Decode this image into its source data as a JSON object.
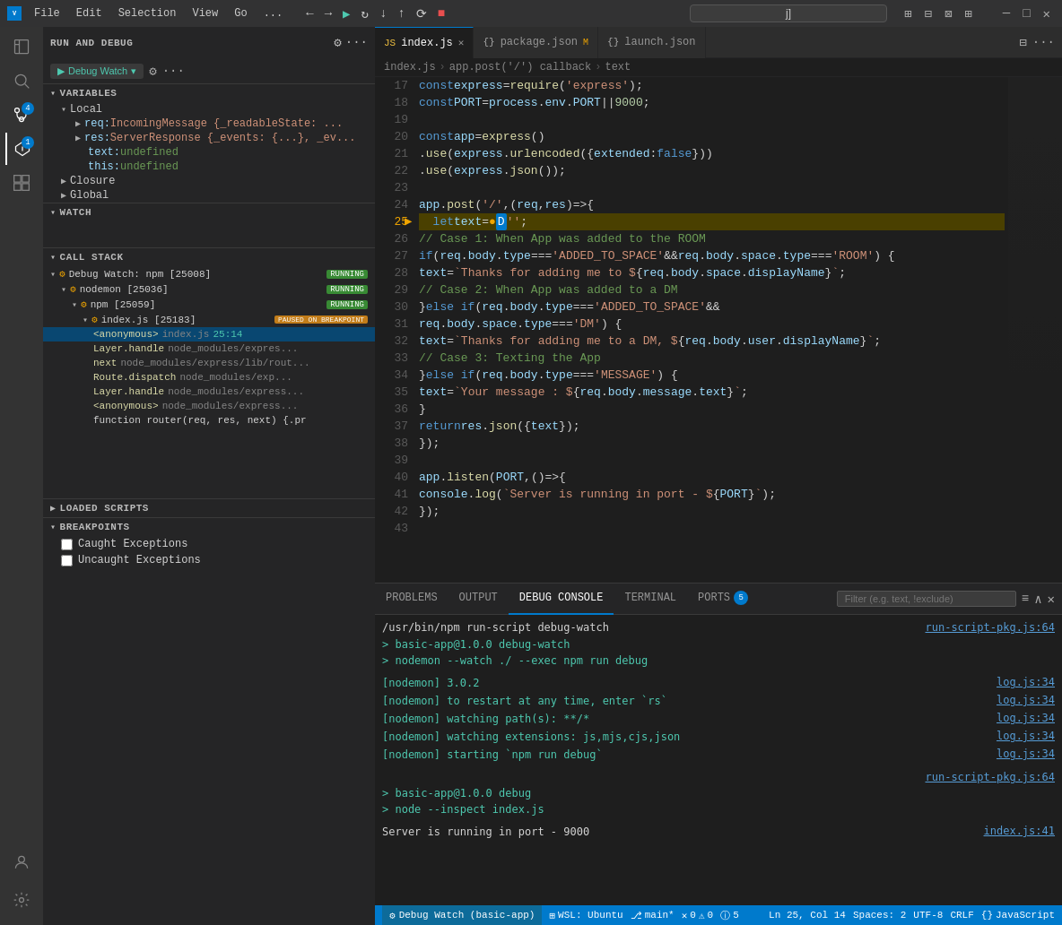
{
  "titlebar": {
    "menus": [
      "File",
      "Edit",
      "Selection",
      "View",
      "Go",
      "..."
    ],
    "search_placeholder": "j]",
    "controls": [
      "─",
      "□",
      "✕"
    ]
  },
  "sidebar": {
    "run_debug_title": "RUN AND DEBUG",
    "debug_config": "Debug Watch",
    "sections": {
      "variables": "VARIABLES",
      "watch": "WATCH",
      "call_stack": "CALL STACK",
      "loaded_scripts": "LOADED SCRIPTS",
      "breakpoints": "BREAKPOINTS"
    }
  },
  "variables": {
    "local_label": "Local",
    "items": [
      {
        "name": "req:",
        "type": "IncomingMessage",
        "value": "{_readableState: ..."
      },
      {
        "name": "res:",
        "type": "ServerResponse",
        "value": "{_events: {...}, _ev..."
      },
      {
        "name": "text:",
        "value": "undefined"
      },
      {
        "name": "this:",
        "value": "undefined"
      }
    ],
    "closure_label": "Closure",
    "global_label": "Global"
  },
  "call_stack": {
    "processes": [
      {
        "name": "Debug Watch: npm [25008]",
        "badge": "RUNNING",
        "children": [
          {
            "name": "nodemon [25036]",
            "badge": "RUNNING"
          },
          {
            "name": "npm [25059]",
            "badge": "RUNNING",
            "children": [
              {
                "name": "index.js [25183]",
                "badge": "PAUSED ON BREAKPOINT",
                "frames": [
                  {
                    "name": "<anonymous>",
                    "file": "index.js",
                    "line": "25:14",
                    "selected": true
                  },
                  {
                    "name": "Layer.handle",
                    "file": "node_modules/express/..."
                  },
                  {
                    "name": "next",
                    "file": "node_modules/express/lib/rout..."
                  },
                  {
                    "name": "Route.dispatch",
                    "file": "node_modules/exp..."
                  },
                  {
                    "name": "Layer.handle",
                    "file": "node_modules/express..."
                  },
                  {
                    "name": "<anonymous>",
                    "file": "node_modules/express..."
                  },
                  {
                    "name": "function router(req, res, next) {.pr"
                  }
                ]
              }
            ]
          }
        ]
      }
    ]
  },
  "breakpoints": {
    "items": [
      {
        "label": "Caught Exceptions",
        "checked": false
      },
      {
        "label": "Uncaught Exceptions",
        "checked": false
      }
    ]
  },
  "tabs": [
    {
      "label": "index.js",
      "icon": "JS",
      "active": true,
      "modified": false
    },
    {
      "label": "package.json",
      "icon": "{}",
      "active": false,
      "modified": true
    },
    {
      "label": "launch.json",
      "icon": "{}",
      "active": false,
      "modified": false
    }
  ],
  "breadcrumb": [
    "index.js",
    "app.post('/') callback",
    "text"
  ],
  "code": {
    "lines": [
      {
        "num": 17,
        "content": "const express = require('express');"
      },
      {
        "num": 18,
        "content": "const PORT = process.env.PORT || 9000;"
      },
      {
        "num": 19,
        "content": ""
      },
      {
        "num": 20,
        "content": "const app = express()"
      },
      {
        "num": 21,
        "content": "  .use(express.urlencoded({extended: false}))"
      },
      {
        "num": 22,
        "content": "  .use(express.json());"
      },
      {
        "num": 23,
        "content": ""
      },
      {
        "num": 24,
        "content": "app.post('/', (req, res) => {"
      },
      {
        "num": 25,
        "content": "  let text = ● D'';",
        "debug": true
      },
      {
        "num": 26,
        "content": "  // Case 1: When App was added to the ROOM"
      },
      {
        "num": 27,
        "content": "  if (req.body.type === 'ADDED_TO_SPACE' && req.body.space.type === 'ROOM') {"
      },
      {
        "num": 28,
        "content": "    text = `Thanks for adding me to ${req.body.space.displayName}`;"
      },
      {
        "num": 29,
        "content": "    // Case 2: When App was added to a DM"
      },
      {
        "num": 30,
        "content": "  } else if (req.body.type === 'ADDED_TO_SPACE' &&"
      },
      {
        "num": 31,
        "content": "    req.body.space.type === 'DM') {"
      },
      {
        "num": 32,
        "content": "    text = `Thanks for adding me to a DM, ${req.body.user.displayName}`;"
      },
      {
        "num": 33,
        "content": "    // Case 3: Texting the App"
      },
      {
        "num": 34,
        "content": "  } else if (req.body.type === 'MESSAGE') {"
      },
      {
        "num": 35,
        "content": "    text = `Your message : ${req.body.message.text}`;"
      },
      {
        "num": 36,
        "content": "  }"
      },
      {
        "num": 37,
        "content": "  return res.json({text});"
      },
      {
        "num": 38,
        "content": "});"
      },
      {
        "num": 39,
        "content": ""
      },
      {
        "num": 40,
        "content": "app.listen(PORT, () => {"
      },
      {
        "num": 41,
        "content": "  console.log(`Server is running in port - ${PORT}`);"
      },
      {
        "num": 42,
        "content": "});"
      },
      {
        "num": 43,
        "content": ""
      }
    ]
  },
  "panel": {
    "tabs": [
      "PROBLEMS",
      "OUTPUT",
      "DEBUG CONSOLE",
      "TERMINAL",
      "PORTS"
    ],
    "ports_badge": "5",
    "active_tab": "DEBUG CONSOLE",
    "filter_placeholder": "Filter (e.g. text, !exclude)",
    "content": [
      {
        "type": "cmd",
        "text": "/usr/bin/npm run-script debug-watch",
        "right": "run-script-pkg.js:64"
      },
      {
        "type": "input",
        "text": "> basic-app@1.0.0 debug-watch"
      },
      {
        "type": "input",
        "text": "> nodemon --watch ./ --exec npm run debug"
      },
      {
        "type": "blank"
      },
      {
        "type": "info",
        "text": "[nodemon] 3.0.2",
        "right": "log.js:34"
      },
      {
        "type": "info",
        "text": "[nodemon] to restart at any time, enter `rs`",
        "right": "log.js:34"
      },
      {
        "type": "info",
        "text": "[nodemon] watching path(s): **/*",
        "right": "log.js:34"
      },
      {
        "type": "info",
        "text": "[nodemon] watching extensions: js,mjs,cjs,json",
        "right": "log.js:34"
      },
      {
        "type": "info",
        "text": "[nodemon] starting `npm run debug`",
        "right": "log.js:34"
      },
      {
        "type": "blank"
      },
      {
        "type": "blank",
        "right": "run-script-pkg.js:64"
      },
      {
        "type": "input",
        "text": "> basic-app@1.0.0 debug"
      },
      {
        "type": "input",
        "text": "> node --inspect index.js"
      },
      {
        "type": "blank"
      },
      {
        "type": "output",
        "text": "Server is running in port - 9000",
        "right": "index.js:41"
      }
    ]
  },
  "statusbar": {
    "debug": "Debug Watch (basic-app)",
    "wsl": "WSL: Ubuntu",
    "branch": "main*",
    "errors": "0",
    "warnings": "0",
    "info": "5",
    "position": "Ln 25, Col 14",
    "spaces": "Spaces: 2",
    "encoding": "UTF-8",
    "line_endings": "CRLF",
    "language": "JavaScript"
  },
  "index_js_status": {
    "filename": "index.js"
  }
}
